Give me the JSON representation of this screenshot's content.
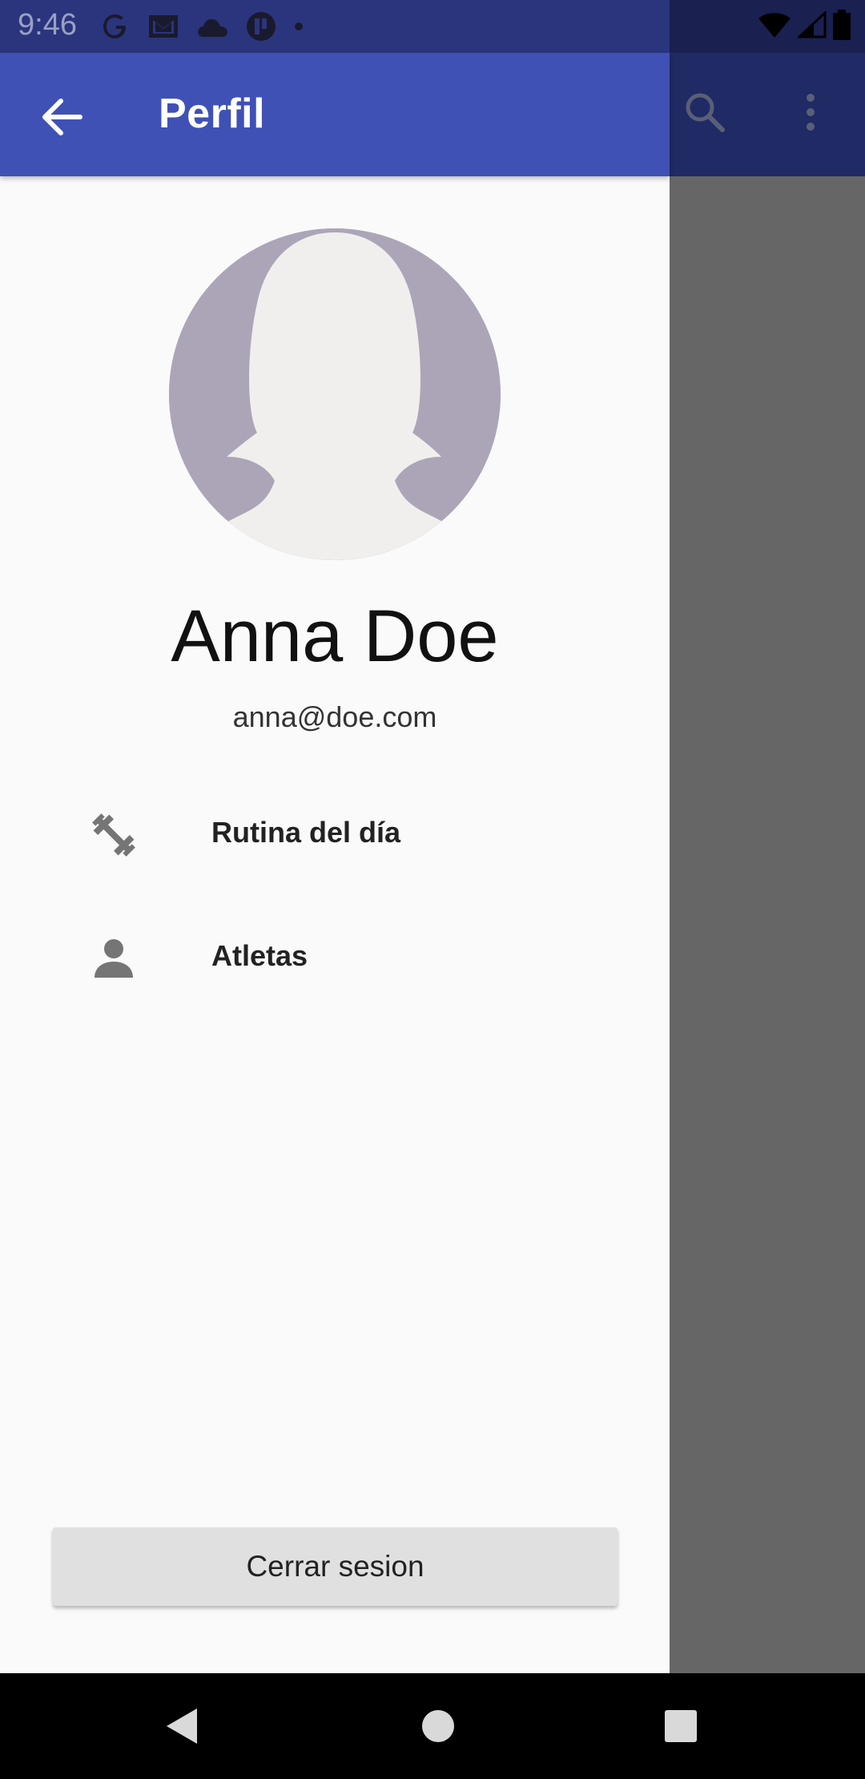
{
  "status_bar": {
    "time": "9:46",
    "icons": [
      "google-icon",
      "gmail-icon",
      "cloud-icon",
      "app-icon",
      "dot-icon",
      "wifi-icon",
      "signal-icon",
      "battery-icon"
    ]
  },
  "app_bar": {
    "title": "Perfil",
    "color": "#3f51b5",
    "actions": [
      "search-icon",
      "more-vert-icon"
    ]
  },
  "profile": {
    "name": "Anna Doe",
    "email": "anna@doe.com",
    "avatar": "female-avatar-placeholder"
  },
  "menu": {
    "items": [
      {
        "label": "Rutina del día",
        "icon": "dumbbell-icon"
      },
      {
        "label": "Atletas",
        "icon": "person-icon"
      }
    ]
  },
  "logout": {
    "label": "Cerrar sesion"
  },
  "navigation_bar": {
    "buttons": [
      "back-icon",
      "home-icon",
      "recents-icon"
    ]
  }
}
